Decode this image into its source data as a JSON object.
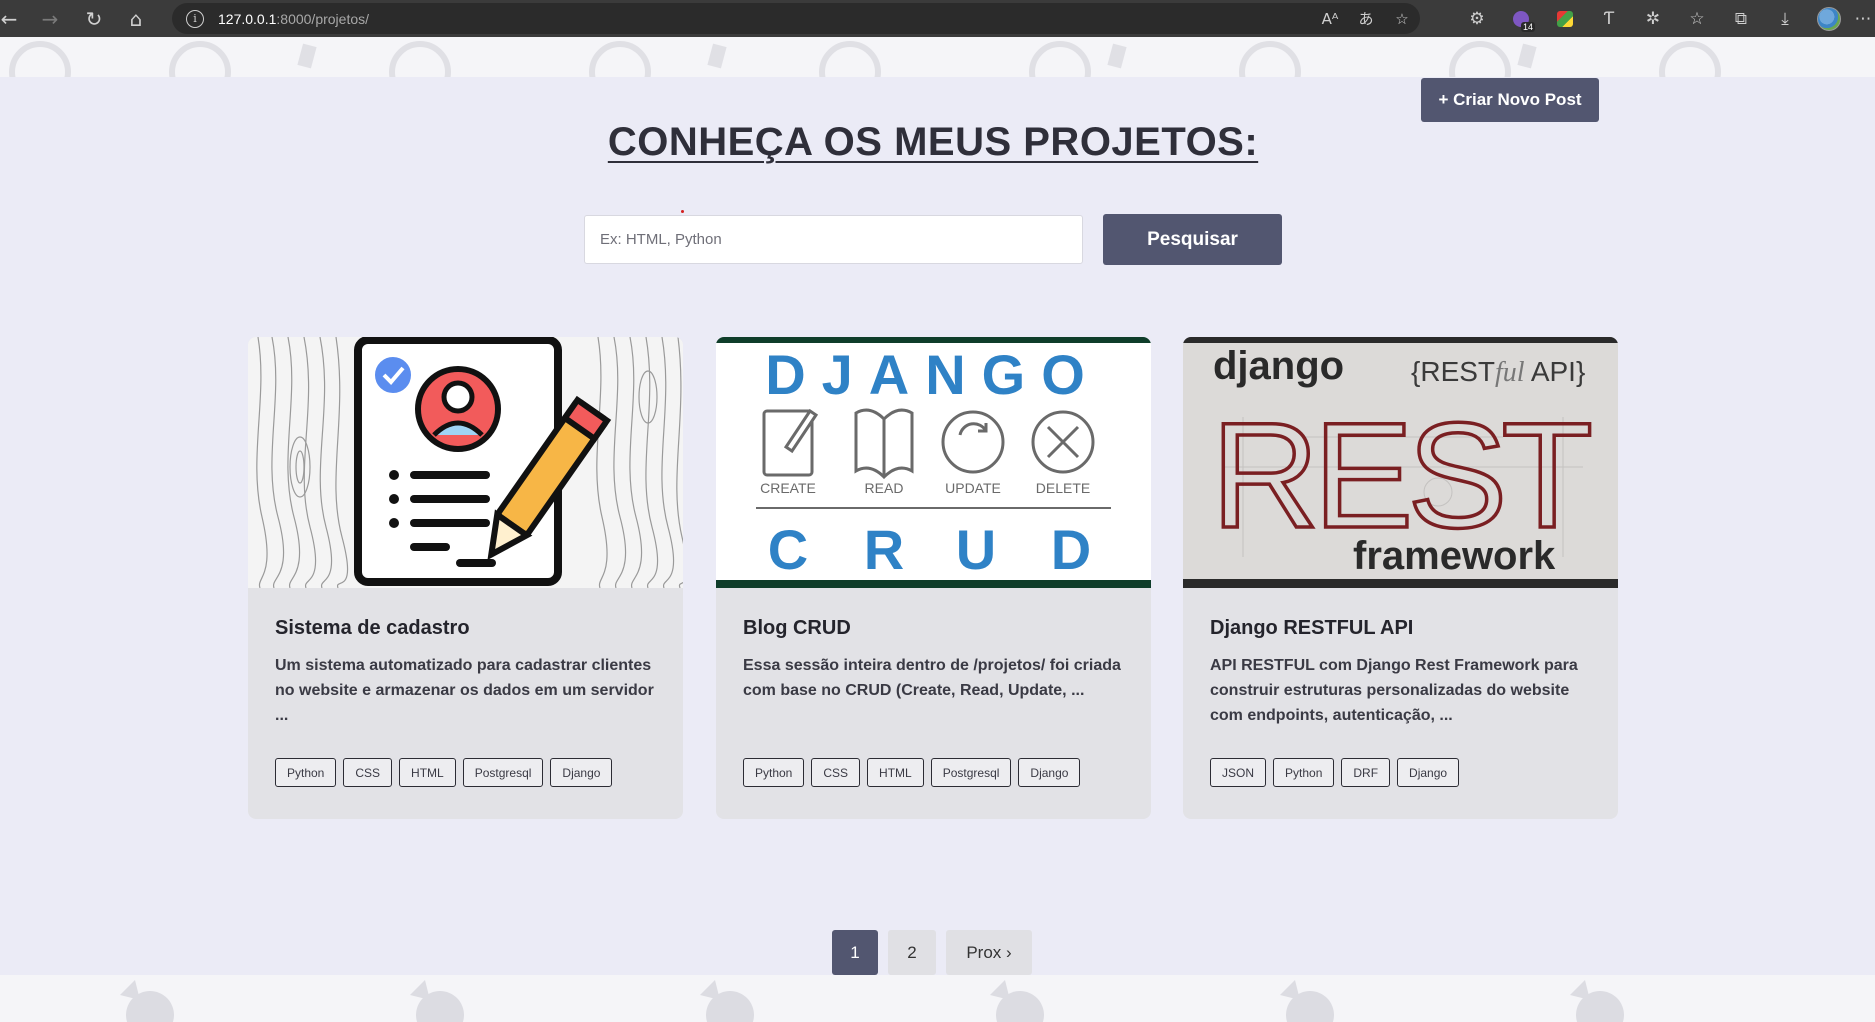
{
  "browser": {
    "url_host": "127.0.0.1",
    "url_path": ":8000/projetos/",
    "extension_badge": "14"
  },
  "header": {
    "new_post_label": "+ Criar Novo Post",
    "title": "CONHEÇA OS MEUS PROJETOS:"
  },
  "search": {
    "placeholder": "Ex: HTML, Python",
    "button_label": "Pesquisar"
  },
  "cards": [
    {
      "title": "Sistema de cadastro",
      "description": "Um sistema automatizado para cadastrar clientes no website e armazenar os dados em um servidor ...",
      "tags": [
        "Python",
        "CSS",
        "HTML",
        "Postgresql",
        "Django"
      ]
    },
    {
      "title": "Blog CRUD",
      "description": "Essa sessão inteira dentro de /projetos/ foi criada com base no CRUD (Create, Read, Update, ...",
      "tags": [
        "Python",
        "CSS",
        "HTML",
        "Postgresql",
        "Django"
      ],
      "image": {
        "top": "DJANGO",
        "labels": [
          "CREATE",
          "READ",
          "UPDATE",
          "DELETE"
        ],
        "letters": [
          "C",
          "R",
          "U",
          "D"
        ]
      }
    },
    {
      "title": "Django RESTFUL API",
      "description": "API RESTFUL com Django Rest Framework para construir estruturas personalizadas do website com endpoints, autenticação, ...",
      "tags": [
        "JSON",
        "Python",
        "DRF",
        "Django"
      ],
      "image": {
        "brand": "django",
        "api_pre": "{REST",
        "api_ful": "ful",
        "api_post": " API}",
        "big": "REST",
        "sub": "framework"
      }
    }
  ],
  "pagination": {
    "pages": [
      "1",
      "2"
    ],
    "next_label": "Prox ›"
  },
  "colors": {
    "accent": "#525670",
    "page_bg": "#ebebf6",
    "card_bg": "#e2e2e6"
  }
}
